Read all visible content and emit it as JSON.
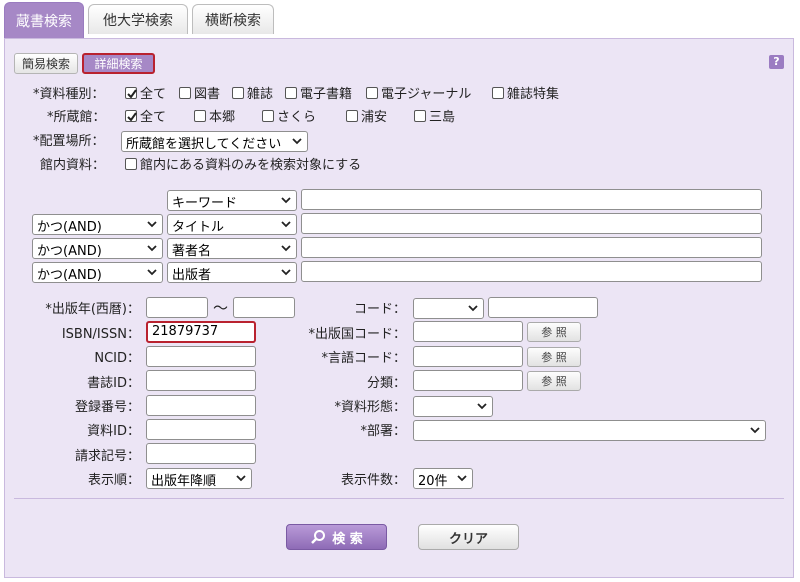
{
  "tabs": [
    "蔵書検索",
    "他大学検索",
    "横断検索"
  ],
  "mode": {
    "simple": "簡易検索",
    "advanced": "詳細検索",
    "help": "?"
  },
  "material_type": {
    "label": "*資料種別：",
    "options": [
      {
        "label": "全て",
        "checked": true
      },
      {
        "label": "図書",
        "checked": false
      },
      {
        "label": "雑誌",
        "checked": false
      },
      {
        "label": "電子書籍",
        "checked": false
      },
      {
        "label": "電子ジャーナル",
        "checked": false
      },
      {
        "label": "雑誌特集",
        "checked": false
      }
    ]
  },
  "library": {
    "label": "*所蔵館：",
    "options": [
      {
        "label": "全て",
        "checked": true
      },
      {
        "label": "本郷",
        "checked": false
      },
      {
        "label": "さくら",
        "checked": false
      },
      {
        "label": "浦安",
        "checked": false
      },
      {
        "label": "三島",
        "checked": false
      }
    ]
  },
  "location": {
    "label": "*配置場所：",
    "value": "所蔵館を選択してください"
  },
  "in_library": {
    "label": "館内資料：",
    "option": "館内にある資料のみを検索対象にする"
  },
  "keyword_rows": [
    {
      "op": "",
      "field": "キーワード",
      "value": ""
    },
    {
      "op": "かつ(AND)",
      "field": "タイトル",
      "value": ""
    },
    {
      "op": "かつ(AND)",
      "field": "著者名",
      "value": ""
    },
    {
      "op": "かつ(AND)",
      "field": "出版者",
      "value": ""
    }
  ],
  "left_fields": {
    "pubyear_label": "*出版年(西暦)：",
    "tilde": "～",
    "isbn_label": "ISBN/ISSN：",
    "isbn_value": "21879737",
    "ncid_label": "NCID：",
    "bibid_label": "書誌ID：",
    "regno_label": "登録番号：",
    "matid_label": "資料ID：",
    "callno_label": "請求記号：",
    "order_label": "表示順：",
    "order_value": "出版年降順"
  },
  "right_fields": {
    "code_label": "コード：",
    "country_label": "*出版国コード：",
    "lang_label": "*言語コード：",
    "class_label": "分類：",
    "form_label": "*資料形態：",
    "dept_label": "*部署：",
    "count_label": "表示件数：",
    "count_value": "20件",
    "ref_label": "参 照"
  },
  "actions": {
    "search": "検 索",
    "clear": "クリア"
  },
  "colors": {
    "accent": "#a688c6",
    "panel": "#ece5f5",
    "highlight": "#b9222f"
  }
}
